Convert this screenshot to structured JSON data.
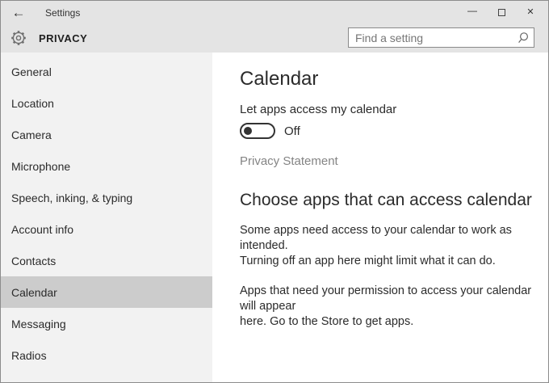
{
  "window": {
    "title": "Settings",
    "controls": {
      "minimize_glyph": "—",
      "maximize_glyph": "outline-square",
      "close_glyph": "✕"
    }
  },
  "header": {
    "back_glyph": "←",
    "section_title": "PRIVACY",
    "icons": {
      "gear": "settings-gear",
      "search": "magnifier"
    },
    "search": {
      "placeholder": "Find a setting",
      "value": ""
    }
  },
  "sidebar": {
    "items": [
      {
        "label": "General",
        "selected": false
      },
      {
        "label": "Location",
        "selected": false
      },
      {
        "label": "Camera",
        "selected": false
      },
      {
        "label": "Microphone",
        "selected": false
      },
      {
        "label": "Speech, inking, & typing",
        "selected": false
      },
      {
        "label": "Account info",
        "selected": false
      },
      {
        "label": "Contacts",
        "selected": false
      },
      {
        "label": "Calendar",
        "selected": true
      },
      {
        "label": "Messaging",
        "selected": false
      },
      {
        "label": "Radios",
        "selected": false
      }
    ]
  },
  "main": {
    "page_title": "Calendar",
    "toggle": {
      "label": "Let apps access my calendar",
      "state_label": "Off",
      "on": false
    },
    "privacy_link": "Privacy Statement",
    "choose_section": {
      "heading": "Choose apps that can access calendar",
      "paragraphs": [
        [
          "Some apps need access to your calendar to work as intended.",
          "Turning off an app here might limit what it can do."
        ],
        [
          "Apps that need your permission to access your calendar will appear",
          "here. Go to the Store to get apps."
        ]
      ]
    }
  },
  "colors": {
    "header_bg": "#e4e4e4",
    "sidebar_bg": "#f2f2f2",
    "selected_item_bg": "#cccccc",
    "content_bg": "#ffffff",
    "text": "#2b2b2b",
    "muted_text": "#848484",
    "window_border": "#8c8c8c"
  }
}
